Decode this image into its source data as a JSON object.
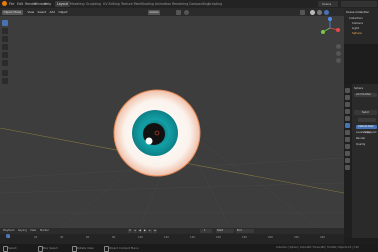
{
  "menu": {
    "items": [
      "File",
      "Edit",
      "Render",
      "Window",
      "Help"
    ],
    "workspaces": [
      "Layout",
      "Modeling",
      "Sculpting",
      "UV Editing",
      "Texture Paint",
      "Shading",
      "Animation",
      "Rendering",
      "Compositing",
      "Scripting"
    ],
    "active_workspace_index": 0,
    "scene_label": "Scene"
  },
  "viewport": {
    "mode": "Object Mode",
    "view_menu": "View",
    "select_menu": "Select",
    "add_menu": "Add",
    "object_menu": "Object",
    "transform": "Global"
  },
  "outliner": {
    "title": "Scene Collection",
    "items": [
      "Collection",
      "Camera",
      "Light",
      "Sphere"
    ]
  },
  "properties": {
    "object_name": "Sphere",
    "add_modifier": "Add Modifier",
    "modifier_name": "Subd",
    "apply_label": "Apply",
    "subdivision_mode": "Catmull-Clark",
    "fields": [
      "Levels Viewport",
      "Render",
      "Quality"
    ]
  },
  "timeline": {
    "playback": "Playback",
    "keying": "Keying",
    "view": "View",
    "marker": "Marker",
    "start": "Start",
    "end": "End",
    "current_frame": "1",
    "ticks": [
      "0",
      "20",
      "40",
      "60",
      "80",
      "100",
      "120",
      "140",
      "160",
      "180",
      "200",
      "220",
      "240"
    ]
  },
  "status": {
    "left1": "Select",
    "left2": "Box Select",
    "mid1": "Rotate View",
    "mid2": "Object Context Menu",
    "right": "Collection | Sphere | Verts:482 | Faces:480 | Tris:960 | Objects:1/3 | 2.90"
  },
  "colors": {
    "iris": "#0f9aa0",
    "accent": "#4772b3"
  }
}
